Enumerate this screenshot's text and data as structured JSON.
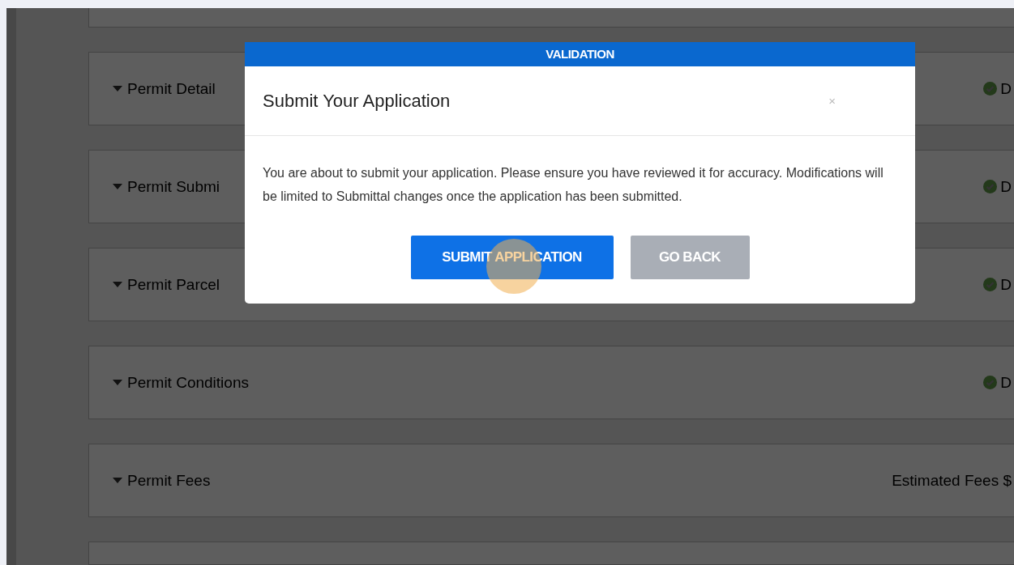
{
  "sections": [
    {
      "title": "Permit Detail",
      "kind": "status",
      "status": "D"
    },
    {
      "title": "Permit Submi",
      "kind": "status",
      "status": "D"
    },
    {
      "title": "Permit Parcel",
      "kind": "status",
      "status": "D"
    },
    {
      "title": "Permit Conditions",
      "kind": "status",
      "status": "D"
    },
    {
      "title": "Permit Fees",
      "kind": "fees",
      "summary": "Estimated Fees $"
    }
  ],
  "modal": {
    "banner": "VALIDATION",
    "title": "Submit Your Application",
    "close": "×",
    "message": "You are about to submit your application. Please ensure you have reviewed it for accuracy. Modifications will be limited to Submittal changes once the application has been submitted.",
    "buttons": [
      {
        "label": "SUBMIT APPLICATION",
        "kind": "primary"
      },
      {
        "label": "GO BACK",
        "kind": "secondary"
      }
    ]
  }
}
